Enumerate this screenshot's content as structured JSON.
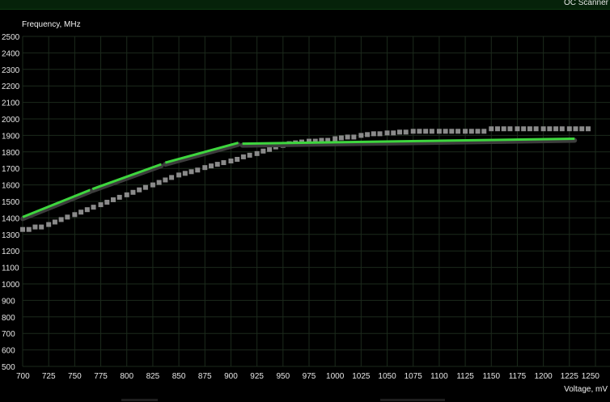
{
  "window": {
    "title": "OC Scanner"
  },
  "chart_data": {
    "type": "line",
    "ylabel": "Frequency, MHz",
    "xlabel": "Voltage, mV",
    "xlim": [
      700,
      1250
    ],
    "ylim": [
      500,
      2500
    ],
    "x_ticks": [
      700,
      725,
      750,
      775,
      800,
      825,
      850,
      875,
      900,
      925,
      950,
      975,
      1000,
      1025,
      1050,
      1075,
      1100,
      1125,
      1150,
      1175,
      1200,
      1225,
      1250
    ],
    "y_ticks": [
      500,
      600,
      700,
      800,
      900,
      1000,
      1100,
      1200,
      1300,
      1400,
      1500,
      1600,
      1700,
      1800,
      1900,
      2000,
      2100,
      2200,
      2300,
      2400,
      2500
    ],
    "grid": true,
    "colors": {
      "background": "#000000",
      "grid": "#1c2a1c",
      "curve": "#3ed63e",
      "reference": "#8a8a8a"
    },
    "series": [
      {
        "role": "reference-points",
        "x": [
          700,
          706,
          712,
          718,
          725,
          731,
          737,
          743,
          750,
          756,
          762,
          768,
          775,
          781,
          787,
          793,
          800,
          806,
          812,
          818,
          825,
          831,
          837,
          843,
          850,
          856,
          862,
          868,
          875,
          881,
          887,
          893,
          900,
          906,
          912,
          918,
          925,
          931,
          937,
          943,
          950,
          956,
          962,
          968,
          975,
          981,
          987,
          993,
          1000,
          1006,
          1012,
          1018,
          1025,
          1031,
          1037,
          1043,
          1050,
          1056,
          1062,
          1068,
          1075,
          1081,
          1087,
          1093,
          1100,
          1106,
          1112,
          1118,
          1125,
          1131,
          1137,
          1143,
          1150,
          1156,
          1162,
          1168,
          1175,
          1181,
          1187,
          1193,
          1200,
          1206,
          1212,
          1218,
          1225,
          1231,
          1237,
          1243
        ],
        "values": [
          1330,
          1330,
          1345,
          1345,
          1360,
          1375,
          1390,
          1405,
          1420,
          1435,
          1450,
          1465,
          1480,
          1495,
          1510,
          1525,
          1540,
          1555,
          1570,
          1585,
          1600,
          1615,
          1630,
          1645,
          1660,
          1670,
          1680,
          1690,
          1705,
          1715,
          1725,
          1735,
          1745,
          1755,
          1770,
          1780,
          1790,
          1805,
          1815,
          1830,
          1840,
          1850,
          1855,
          1860,
          1865,
          1865,
          1870,
          1870,
          1880,
          1885,
          1890,
          1890,
          1900,
          1905,
          1910,
          1910,
          1915,
          1915,
          1920,
          1920,
          1925,
          1925,
          1925,
          1925,
          1925,
          1925,
          1925,
          1925,
          1925,
          1925,
          1925,
          1925,
          1940,
          1940,
          1940,
          1940,
          1940,
          1940,
          1940,
          1940,
          1940,
          1940,
          1940,
          1940,
          1940,
          1940,
          1940,
          1940
        ]
      },
      {
        "role": "curve-segments",
        "segments": [
          [
            [
              700,
              1405
            ],
            [
              765,
              1570
            ]
          ],
          [
            [
              767,
              1575
            ],
            [
              833,
              1725
            ]
          ],
          [
            [
              837,
              1735
            ],
            [
              907,
              1855
            ]
          ],
          [
            [
              911,
              1850
            ],
            [
              1230,
              1880
            ]
          ]
        ]
      }
    ]
  }
}
